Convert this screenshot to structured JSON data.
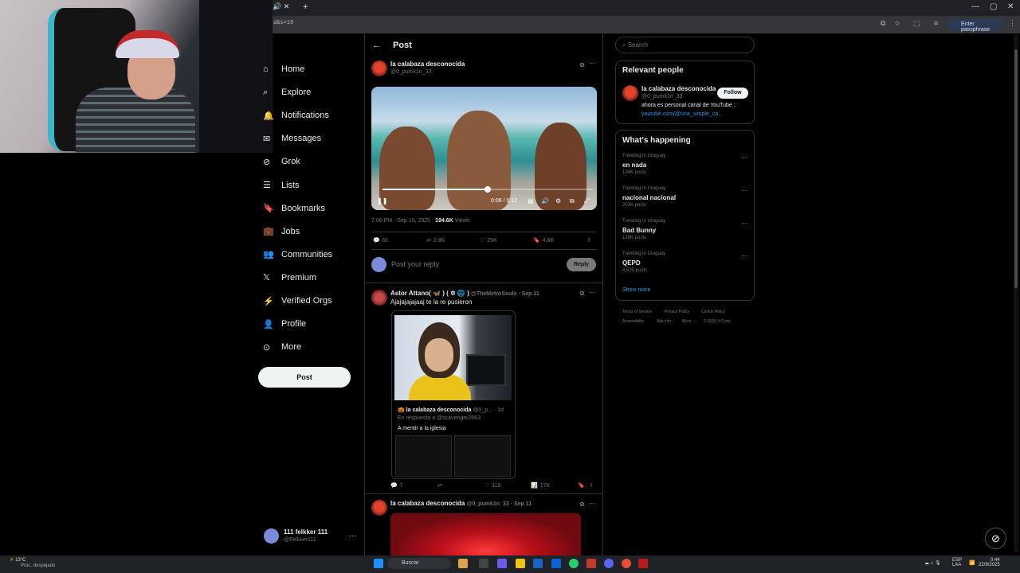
{
  "browser": {
    "url_fragment": "d&s=19",
    "passphrase_label": "Enter passphrase"
  },
  "sidebar": {
    "items": [
      {
        "label": "Home",
        "icon": "home-icon"
      },
      {
        "label": "Explore",
        "icon": "search-icon"
      },
      {
        "label": "Notifications",
        "icon": "bell-icon"
      },
      {
        "label": "Messages",
        "icon": "mail-icon"
      },
      {
        "label": "Grok",
        "icon": "grok-icon"
      },
      {
        "label": "Lists",
        "icon": "list-icon"
      },
      {
        "label": "Bookmarks",
        "icon": "bookmark-icon"
      },
      {
        "label": "Jobs",
        "icon": "briefcase-icon"
      },
      {
        "label": "Communities",
        "icon": "people-icon"
      },
      {
        "label": "Premium",
        "icon": "x-logo-icon"
      },
      {
        "label": "Verified Orgs",
        "icon": "lightning-icon"
      },
      {
        "label": "Profile",
        "icon": "person-icon"
      },
      {
        "label": "More",
        "icon": "more-circle-icon"
      }
    ],
    "post_button": "Post",
    "account": {
      "name": "111 felkker 111",
      "handle": "@Felkker111"
    }
  },
  "main": {
    "header_title": "Post",
    "post": {
      "author": "la calabaza desconocida",
      "handle": "@0_pumk1n_33",
      "video_time": "0:06 / 0:12",
      "video_progress": 0.5,
      "timestamp": "7:06 PM · Sep 10, 2025 · ",
      "views_count": "194.6K",
      "views_label": "Views",
      "replies": "61",
      "reposts": "2.8K",
      "likes": "25K",
      "bookmarks": "4.8K"
    },
    "reply_placeholder": "Post your reply",
    "reply_button": "Reply",
    "reply1": {
      "author": "Astor Attano( 🦋 ) ( ✡ 🌐 )",
      "handle": "@TheMetroSouls · Sep 11",
      "text": "Ajajajajajaaj te la re pusieron",
      "quote_author": "🎃 la calabaza desconocida",
      "quote_handle": "@0_p... · 1d",
      "quote_reply_to": "En respuesta a @scavenger2063",
      "quote_text": "A mentir a la iglesia",
      "replies": "7",
      "likes": "118",
      "views": "17K"
    },
    "reply2": {
      "author": "la calabaza desconocida",
      "handle": "@0_pumk1n_33 · Sep 11"
    }
  },
  "right": {
    "search_placeholder": "Search",
    "relevant_title": "Relevant people",
    "relevant": {
      "name": "la calabaza desconocida",
      "handle": "@0_pumk1n_33",
      "follow": "Follow",
      "bio": "ahora es personal canal de YouTube :",
      "link": "youtube.com/@una_simple_ca..."
    },
    "happening_title": "What's happening",
    "trends": [
      {
        "category": "Trending in Uruguay",
        "name": "en nada",
        "count": "134K posts"
      },
      {
        "category": "Trending in Uruguay",
        "name": "nacional nacional",
        "count": "203K posts"
      },
      {
        "category": "Trending in Uruguay",
        "name": "Bad Bunny",
        "count": "128K posts"
      },
      {
        "category": "Trending in Uruguay",
        "name": "QEPD",
        "count": "4,535 posts"
      }
    ],
    "show_more": "Show more",
    "footer": [
      "Terms of Service",
      "Privacy Policy",
      "Cookie Policy",
      "Accessibility",
      "Ads info",
      "More ···",
      "© 2025 X Corp."
    ]
  },
  "taskbar": {
    "temp": "13°C",
    "weather": "Prac. despejado",
    "search": "Buscar",
    "lang1": "ESP",
    "lang2": "LAA",
    "time": "0:44",
    "date": "22/9/2025"
  }
}
